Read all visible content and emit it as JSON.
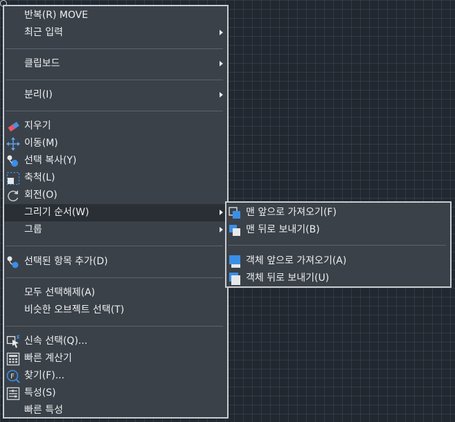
{
  "context_menu": {
    "items": [
      {
        "label": "반복(R) MOVE"
      },
      {
        "label": "최근 입력"
      },
      {
        "label": "클립보드"
      },
      {
        "label": "분리(I)"
      },
      {
        "label": "지우기",
        "icon": "eraser-icon"
      },
      {
        "label": "이동(M)",
        "icon": "move-icon"
      },
      {
        "label": "선택 복사(Y)",
        "icon": "copy-selection-icon"
      },
      {
        "label": "축척(L)",
        "icon": "scale-icon"
      },
      {
        "label": "회전(O)",
        "icon": "rotate-icon"
      },
      {
        "label": "그리기 순서(W)"
      },
      {
        "label": "그룹"
      },
      {
        "label": "선택된 항목 추가(D)",
        "icon": "add-selected-icon"
      },
      {
        "label": "모두 선택해제(A)"
      },
      {
        "label": "비슷한 오브젝트 선택(T)"
      },
      {
        "label": "신속 선택(Q)...",
        "icon": "quick-select-icon"
      },
      {
        "label": "빠른 계산기",
        "icon": "calculator-icon"
      },
      {
        "label": "찾기(F)...",
        "icon": "find-icon"
      },
      {
        "label": "특성(S)",
        "icon": "properties-icon"
      },
      {
        "label": "빠른 특성"
      }
    ]
  },
  "draw_order_submenu": {
    "items": [
      {
        "label": "맨 앞으로 가져오기(F)",
        "icon": "bring-to-front-icon"
      },
      {
        "label": "맨 뒤로 보내기(B)",
        "icon": "send-to-back-icon"
      },
      {
        "label": "객체 앞으로 가져오기(A)",
        "icon": "bring-above-objects-icon"
      },
      {
        "label": "객체 뒤로 보내기(U)",
        "icon": "send-under-objects-icon"
      }
    ]
  },
  "colors": {
    "canvas_bg": "#212830",
    "menu_bg": "#3b4148",
    "menu_border": "#c9cdd1",
    "hover_bg": "#2a2f35",
    "text": "#eceff2",
    "icon_blue": "#3b8fe6"
  }
}
